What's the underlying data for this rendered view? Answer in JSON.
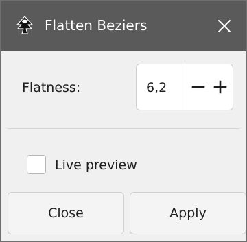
{
  "window": {
    "title": "Flatten Beziers",
    "app_icon": "inkscape-logo-icon",
    "close_icon": "close-icon"
  },
  "form": {
    "flatness_label": "Flatness:",
    "flatness_value": "6,2",
    "decrement_icon": "minus-icon",
    "increment_icon": "plus-icon"
  },
  "preview": {
    "label": "Live preview",
    "checked": false
  },
  "buttons": {
    "close_label": "Close",
    "apply_label": "Apply"
  },
  "colors": {
    "titlebar": "#5a5a5a",
    "dialog_background": "#f0f0f0",
    "text": "#1f1f1f"
  }
}
